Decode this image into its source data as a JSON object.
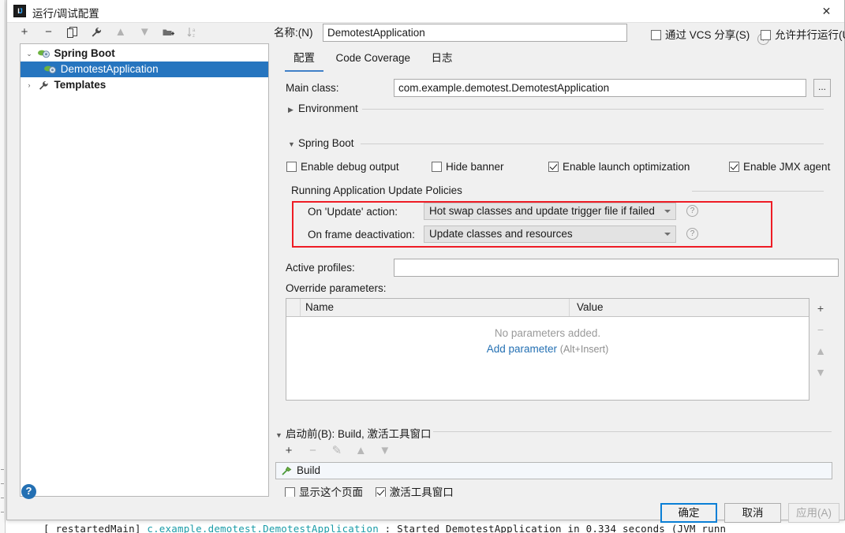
{
  "window": {
    "title": "运行/调试配置",
    "icon_name": "intellij-idea-icon",
    "close_label": "✕"
  },
  "background": {
    "console_prefix": "[  restartedMain] ",
    "console_class": "c.example.demotest.DemotestApplication",
    "console_suffix": "   : Started DemotestApplication in 0.334 seconds (JVM runn"
  },
  "left_toolbar": {
    "add": "+",
    "remove": "−",
    "copy": "copy-icon",
    "edit_templates": "wrench-icon",
    "move_up": "▲",
    "move_down": "▼",
    "new_folder": "folder-plus-icon",
    "sort": "sort-az-icon"
  },
  "tree": {
    "nodes": [
      {
        "label": "Spring Boot",
        "twisty": "⌄",
        "icon": "spring-boot-icon",
        "bold": true,
        "selected": false,
        "indent": false
      },
      {
        "label": "DemotestApplication",
        "twisty": "",
        "icon": "spring-boot-icon",
        "bold": false,
        "selected": true,
        "indent": true
      },
      {
        "label": "Templates",
        "twisty": "›",
        "icon": "wrench-icon",
        "bold": true,
        "selected": false,
        "indent": false
      }
    ]
  },
  "header": {
    "name_label": "名称:(N)",
    "name_value": "DemotestApplication",
    "share_vcs_label": "通过 VCS 分享(S)",
    "share_vcs_checked": false,
    "share_help": "?",
    "allow_parallel_label": "允许并行运行(U)",
    "allow_parallel_checked": false
  },
  "tabs": [
    {
      "label": "配置",
      "active": true
    },
    {
      "label": "Code Coverage",
      "active": false
    },
    {
      "label": "日志",
      "active": false
    }
  ],
  "config": {
    "main_class_label": "Main class:",
    "main_class_value": "com.example.demotest.DemotestApplication",
    "browse_button": "...",
    "environment_section": "Environment",
    "environment_expanded": false,
    "spring_boot_section": "Spring Boot",
    "spring_boot_expanded": true,
    "checkboxes": [
      {
        "label": "Enable debug output",
        "checked": false
      },
      {
        "label": "Hide banner",
        "checked": false
      },
      {
        "label": "Enable launch optimization",
        "checked": true
      },
      {
        "label": "Enable JMX agent",
        "checked": true
      }
    ],
    "update_policies_title": "Running Application Update Policies",
    "on_update_label": "On 'Update' action:",
    "on_update_value": "Hot swap classes and update trigger file if failed",
    "on_frame_label": "On frame deactivation:",
    "on_frame_value": "Update classes and resources",
    "help_icon": "?",
    "highlight_color": "#ee1c25",
    "active_profiles_label": "Active profiles:",
    "active_profiles_value": "",
    "override_params_label": "Override parameters:",
    "params_col_name": "Name",
    "params_col_value": "Value",
    "params_empty_text": "No parameters added.",
    "params_add_link": "Add parameter",
    "params_add_hint": "(Alt+Insert)",
    "params_side_add": "+",
    "params_side_remove": "−",
    "params_side_up": "▲",
    "params_side_down": "▼"
  },
  "before_launch": {
    "title": "启动前(B): Build, 激活工具窗口",
    "toolbar": {
      "add": "+",
      "remove": "−",
      "edit": "✎",
      "up": "▲",
      "down": "▼"
    },
    "items": [
      {
        "label": "Build",
        "icon": "hammer-icon"
      }
    ],
    "show_page_label": "显示这个页面",
    "show_page_checked": false,
    "activate_window_label": "激活工具窗口",
    "activate_window_checked": true
  },
  "footer": {
    "help": "?",
    "ok": "确定",
    "cancel": "取消",
    "apply": "应用(A)",
    "apply_disabled": true
  }
}
